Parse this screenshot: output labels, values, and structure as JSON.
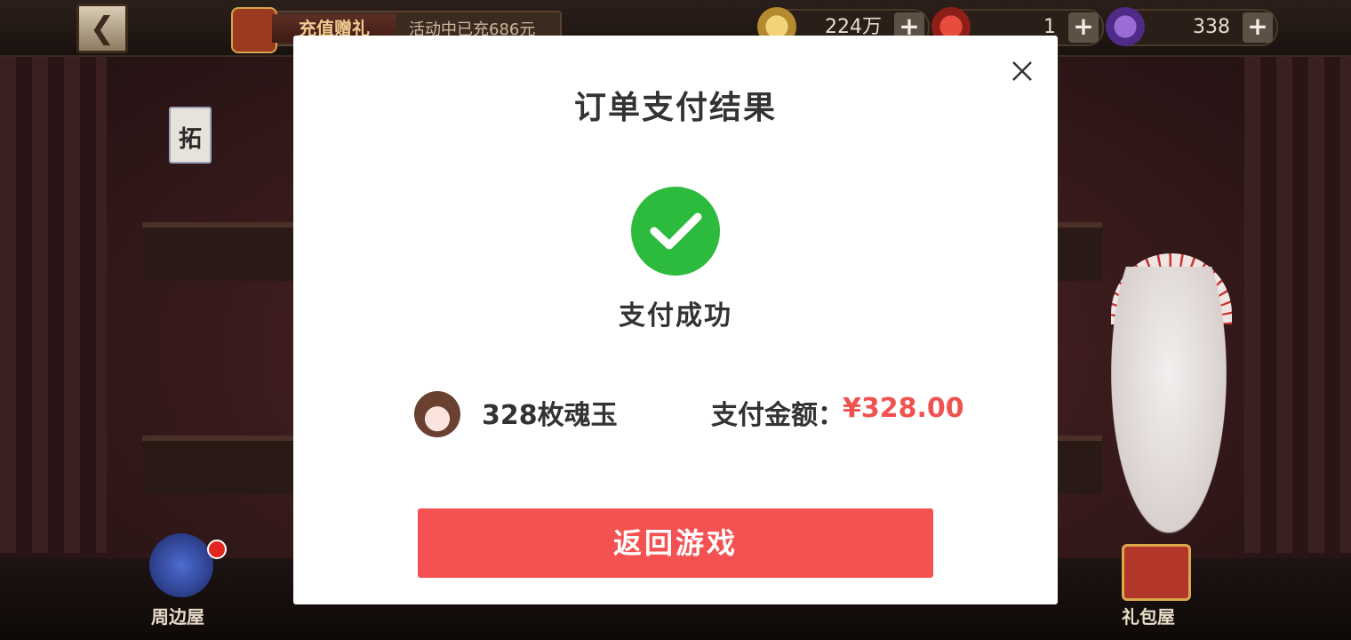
{
  "game_hud": {
    "promo": {
      "tag": "充值赠礼",
      "subtitle": "活动中已充686元"
    },
    "resources": [
      {
        "icon": "coin-icon",
        "value": "224万"
      },
      {
        "icon": "red-magatama-icon",
        "value": "1"
      },
      {
        "icon": "purple-magatama-icon",
        "value": "338"
      }
    ],
    "plus_label": "+",
    "tag_tile": "拓",
    "bottom_left_label": "周边屋",
    "bottom_right_label": "礼包屋"
  },
  "modal": {
    "title": "订单支付结果",
    "status_text": "支付成功",
    "product_name": "328枚魂玉",
    "amount_label": "支付金额：",
    "amount_value": "¥328.00",
    "return_button": "返回游戏"
  },
  "colors": {
    "success_green": "#2dbb3e",
    "accent_red": "#f45252",
    "amount_red": "#f05250"
  }
}
